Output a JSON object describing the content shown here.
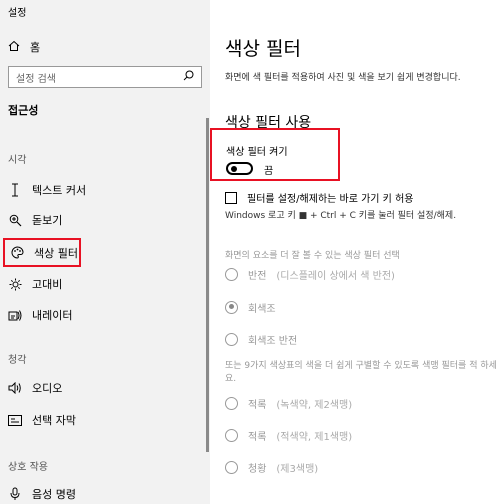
{
  "window": {
    "title": "설정"
  },
  "sidebar": {
    "home_label": "홈",
    "search_placeholder": "설정 검색",
    "section_title": "접근성",
    "groups": {
      "vision": "시각",
      "hearing": "청각",
      "interaction": "상호 작용"
    },
    "items": {
      "text_cursor": "텍스트 커서",
      "magnifier": "돋보기",
      "color_filters": "색상 필터",
      "high_contrast": "고대비",
      "narrator": "내레이터",
      "audio": "오디오",
      "captions": "선택 자막",
      "speech": "음성 명령"
    }
  },
  "main": {
    "title": "색상 필터",
    "description": "화면에 색 필터를 적용하여 사진 및 색을 보기 쉽게 변경합니다.",
    "use_section_title": "색상 필터 사용",
    "toggle_label": "색상 필터 켜기",
    "toggle_state": "끔",
    "shortcut_label": "필터를 설정/해제하는 바로 가기 키 허용",
    "shortcut_help": "Windows 로고 키 ■ + Ctrl + C 키를 눌러 필터 설정/해제.",
    "filter_select_title": "화면의 요소를 더 잘 볼 수 있는 색상 필터 선택",
    "filters": [
      {
        "label": "반전",
        "detail": "(디스플레이 상에서 색 반전)",
        "selected": false
      },
      {
        "label": "회색조",
        "detail": "",
        "selected": true
      },
      {
        "label": "회색조 반전",
        "detail": "",
        "selected": false
      }
    ],
    "colorblind_desc": "또는 9가지 색상표의 색을 더 쉽게 구별할 수 있도록 색맹 필터를 적 하세요.",
    "colorblind_filters": [
      {
        "label": "적록",
        "detail": "(녹색약, 제2색맹)"
      },
      {
        "label": "적록",
        "detail": "(적색약, 제1색맹)"
      },
      {
        "label": "청황",
        "detail": "(제3색맹)"
      }
    ]
  }
}
